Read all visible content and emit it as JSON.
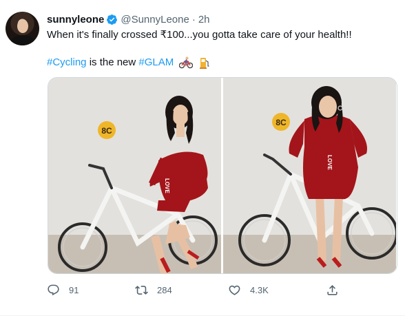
{
  "tweet": {
    "display_name": "sunnyleone",
    "handle": "@SunnyLeone",
    "separator": "·",
    "time": "2h",
    "text_line1": "When it's finally crossed ₹100...you gotta take care of your health!!",
    "hashtag1": "#Cycling",
    "text_mid": " is the new ",
    "hashtag2": "#GLAM",
    "emojis": [
      "bicycle-rider-emoji",
      "fuel-pump-emoji"
    ]
  },
  "actions": {
    "reply_count": "91",
    "retweet_count": "284",
    "like_count": "4.3K"
  },
  "photos": {
    "badge_text": "8C",
    "belt_text": "LOVE"
  },
  "colors": {
    "accent": "#1d9bf0",
    "text_secondary": "#536471",
    "dress_red": "#a3151a"
  }
}
